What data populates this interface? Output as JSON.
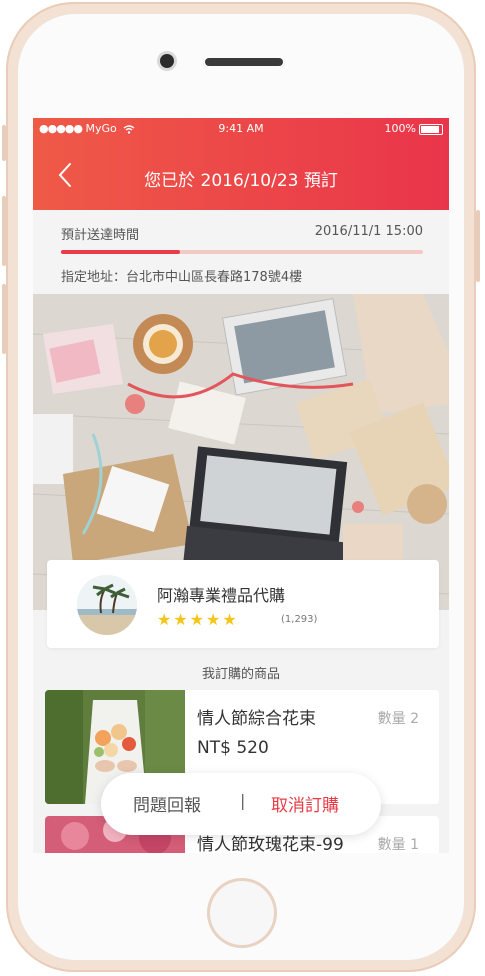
{
  "status_bar": {
    "carrier": "MyGo",
    "time": "9:41 AM",
    "battery": "100%"
  },
  "header": {
    "title": "您已於 2016/10/23 預訂",
    "back_icon": "chevron-left-icon"
  },
  "delivery": {
    "label": "預計送達時間",
    "time": "2016/11/1 15:00",
    "progress_fraction": 0.33,
    "address": "指定地址：台北市中山區長春路178號4樓"
  },
  "seller": {
    "name": "阿瀚專業禮品代購",
    "stars": "★★★★★",
    "rating_count": "(1,293)"
  },
  "section_title": "我訂購的商品",
  "items": [
    {
      "name": "情人節綜合花束",
      "qty": "數量 2",
      "price": "NT$ 520"
    },
    {
      "name": "情人節玫瑰花束-99",
      "qty": "數量 1"
    }
  ],
  "actions": {
    "report_label": "問題回報",
    "separator": "|",
    "cancel_label": "取消訂購"
  },
  "colors": {
    "accent": "#e93b46",
    "header_start": "#ef5a47",
    "header_end": "#e9354a",
    "star": "#f5c518"
  }
}
